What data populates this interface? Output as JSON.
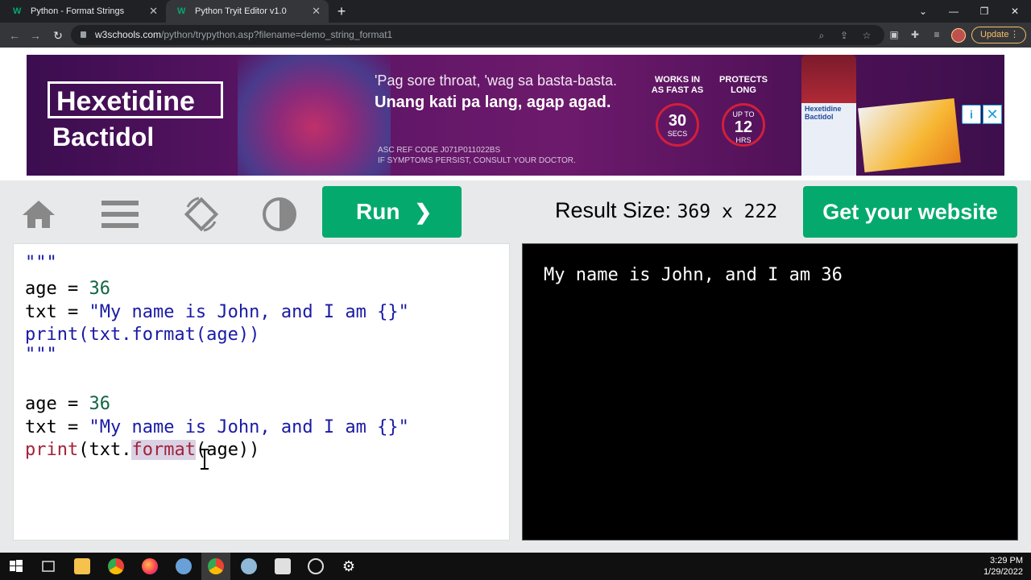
{
  "browser": {
    "tabs": [
      {
        "label": "Python - Format Strings",
        "favicon": "W"
      },
      {
        "label": "Python Tryit Editor v1.0",
        "favicon": "W"
      }
    ],
    "url_host": "w3schools.com",
    "url_path": "/python/trypython.asp?filename=demo_string_format1",
    "update_label": "Update",
    "update_dots": "⋮"
  },
  "ad": {
    "brand_line1": "Hexetidine",
    "brand_line2": "Bactidol",
    "headline": "'Pag sore throat, 'wag sa basta-basta.",
    "subheadline": "Unang kati pa lang, agap agad.",
    "ref_code": "ASC REF CODE J071P011022BS",
    "disclaimer": "IF SYMPTOMS PERSIST, CONSULT YOUR DOCTOR.",
    "stat1_label": "WORKS IN\nAS FAST AS",
    "stat1_value": "30",
    "stat1_unit": "SECS",
    "stat2_label": "PROTECTS\nLONG",
    "stat2_prefix": "UP TO",
    "stat2_value": "12",
    "stat2_unit": "HRS",
    "bottle_label": "Hexetidine Bactidol",
    "info_icon": "i",
    "close_icon": "✕"
  },
  "tryit": {
    "run_label": "Run",
    "run_arrow": "❯",
    "result_size_label": "Result Size:",
    "result_size_value": "369 x 222",
    "website_label": "Get your website"
  },
  "code": {
    "line1": "\"\"\"",
    "line2_a": "age = ",
    "line2_num": "36",
    "line3_a": "txt = ",
    "line3_str": "\"My name is John, and I am {}\"",
    "line4": "print(txt.format(age))",
    "line5": "\"\"\"",
    "line6_a": "age = ",
    "line6_num": "36",
    "line7_a": "txt = ",
    "line7_str": "\"My name is John, and I am {}\"",
    "line8_kw": "print",
    "line8_b": "(txt.",
    "line8_sel": "format",
    "line8_c": "(age))"
  },
  "result": {
    "output": "My name is John, and I am 36"
  },
  "taskbar": {
    "time": "3:29 PM",
    "date": "1/29/2022"
  },
  "colors": {
    "accent": "#04aa6d",
    "result_bg": "#000000"
  }
}
